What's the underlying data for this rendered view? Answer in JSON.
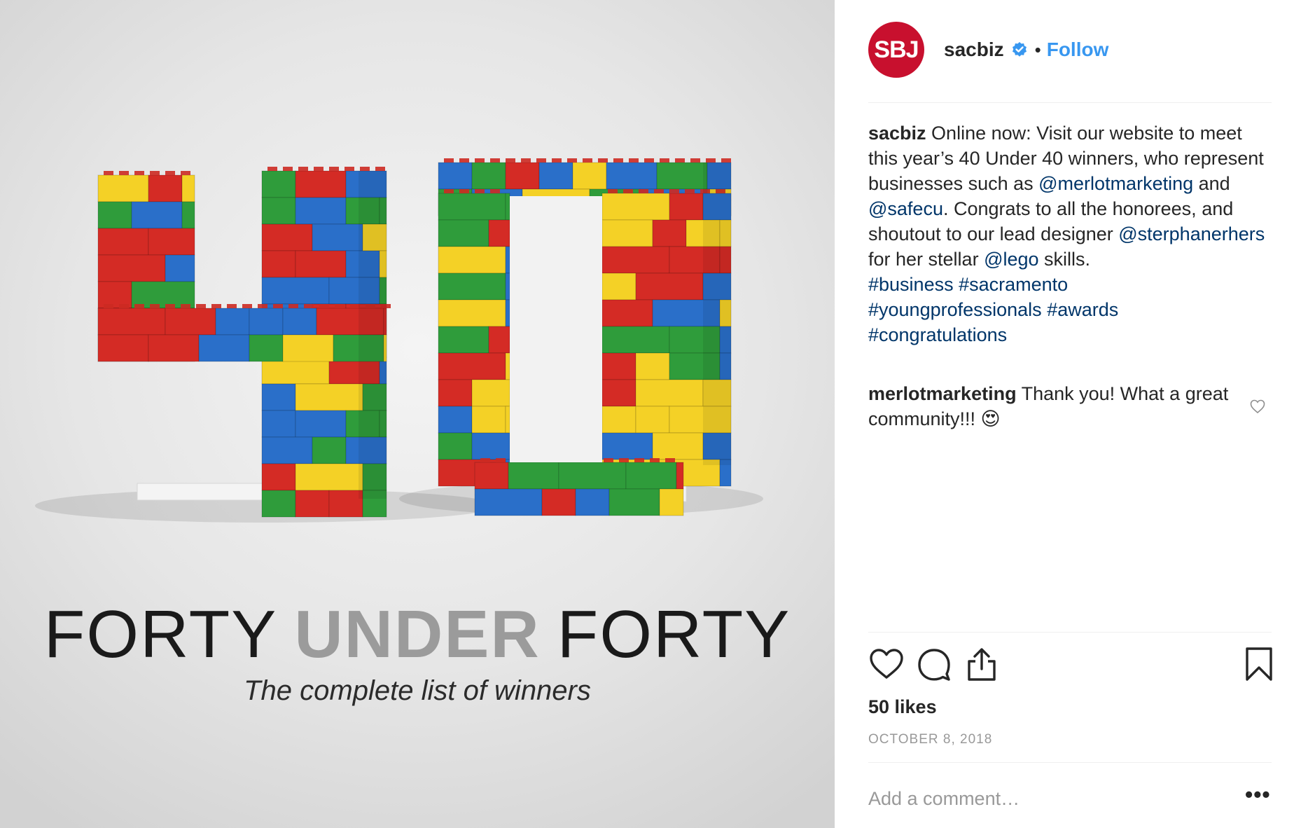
{
  "post_image": {
    "headline_thin_1": "FORTY",
    "headline_bold": "UNDER",
    "headline_thin_2": "FORTY",
    "subhead": "The complete list of winners",
    "brick_colors": [
      "#d42b25",
      "#2a6fc9",
      "#f4d126",
      "#2f9c3b"
    ]
  },
  "header": {
    "avatar_text": "SBJ",
    "avatar_color": "#c8102e",
    "username": "sacbiz",
    "separator": "•",
    "follow_label": "Follow"
  },
  "caption": {
    "username": "sacbiz",
    "text_1": " Online now: Visit our website to meet this year’s 40 Under 40 winners, who represent businesses such as ",
    "mention_1": "@merlotmarketing",
    "text_2": " and ",
    "mention_2": "@safecu",
    "text_3": ". Congrats to all the honorees, and shoutout to our lead designer ",
    "mention_3": "@sterphanerhers",
    "text_4": " for her stellar ",
    "mention_4": "@lego",
    "text_5": " skills.",
    "hashtags": [
      "#business",
      "#sacramento",
      "#youngprofessionals",
      "#awards",
      "#congratulations"
    ]
  },
  "comment": {
    "username": "merlotmarketing",
    "text": " Thank you! What a great community!!! 😍"
  },
  "actions": {
    "like_icon": "heart-icon",
    "comment_icon": "comment-icon",
    "share_icon": "share-icon",
    "save_icon": "bookmark-icon"
  },
  "likes": "50 likes",
  "date": "OCTOBER 8, 2018",
  "add_comment": {
    "placeholder": "Add a comment…"
  },
  "more_label": "•••",
  "colors": {
    "link": "#003569",
    "follow": "#3897f0",
    "muted": "#999999"
  }
}
